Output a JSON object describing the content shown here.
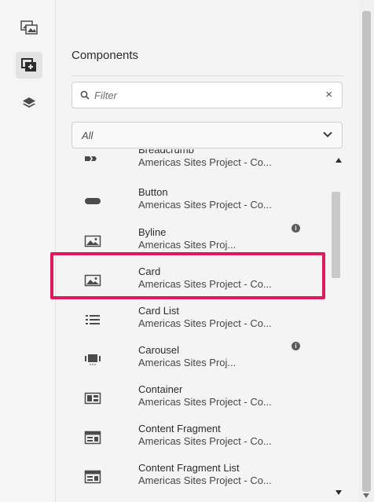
{
  "panel": {
    "title": "Components",
    "filter": {
      "placeholder": "Filter",
      "clear_symbol": "×"
    },
    "group_select": {
      "value": "All"
    }
  },
  "rail": {
    "buttons": [
      {
        "icon": "assets-icon",
        "active": false
      },
      {
        "icon": "components-icon",
        "active": true
      },
      {
        "icon": "layers-icon",
        "active": false
      }
    ]
  },
  "components": [
    {
      "name": "Breadcrumb",
      "description": "Americas Sites Project - Co...",
      "icon": "breadcrumb-icon",
      "info": false
    },
    {
      "name": "Button",
      "description": "Americas Sites Project - Co...",
      "icon": "button-icon",
      "info": false
    },
    {
      "name": "Byline",
      "description": "Americas Sites Proj...",
      "icon": "image-icon",
      "info": true
    },
    {
      "name": "Card",
      "description": "Americas Sites Project - Co...",
      "icon": "image-icon",
      "info": false
    },
    {
      "name": "Card List",
      "description": "Americas Sites Project - Co...",
      "icon": "list-icon",
      "info": false
    },
    {
      "name": "Carousel",
      "description": "Americas Sites Proj...",
      "icon": "carousel-icon",
      "info": true
    },
    {
      "name": "Container",
      "description": "Americas Sites Project - Co...",
      "icon": "container-icon",
      "info": false
    },
    {
      "name": "Content Fragment",
      "description": "Americas Sites Project - Co...",
      "icon": "content-fragment-icon",
      "info": false
    },
    {
      "name": "Content Fragment List",
      "description": "Americas Sites Project - Co...",
      "icon": "content-fragment-icon",
      "info": false
    }
  ],
  "info_glyph": "i",
  "colors": {
    "highlight": "#e0195a",
    "panel_bg": "#f4f4f4"
  }
}
